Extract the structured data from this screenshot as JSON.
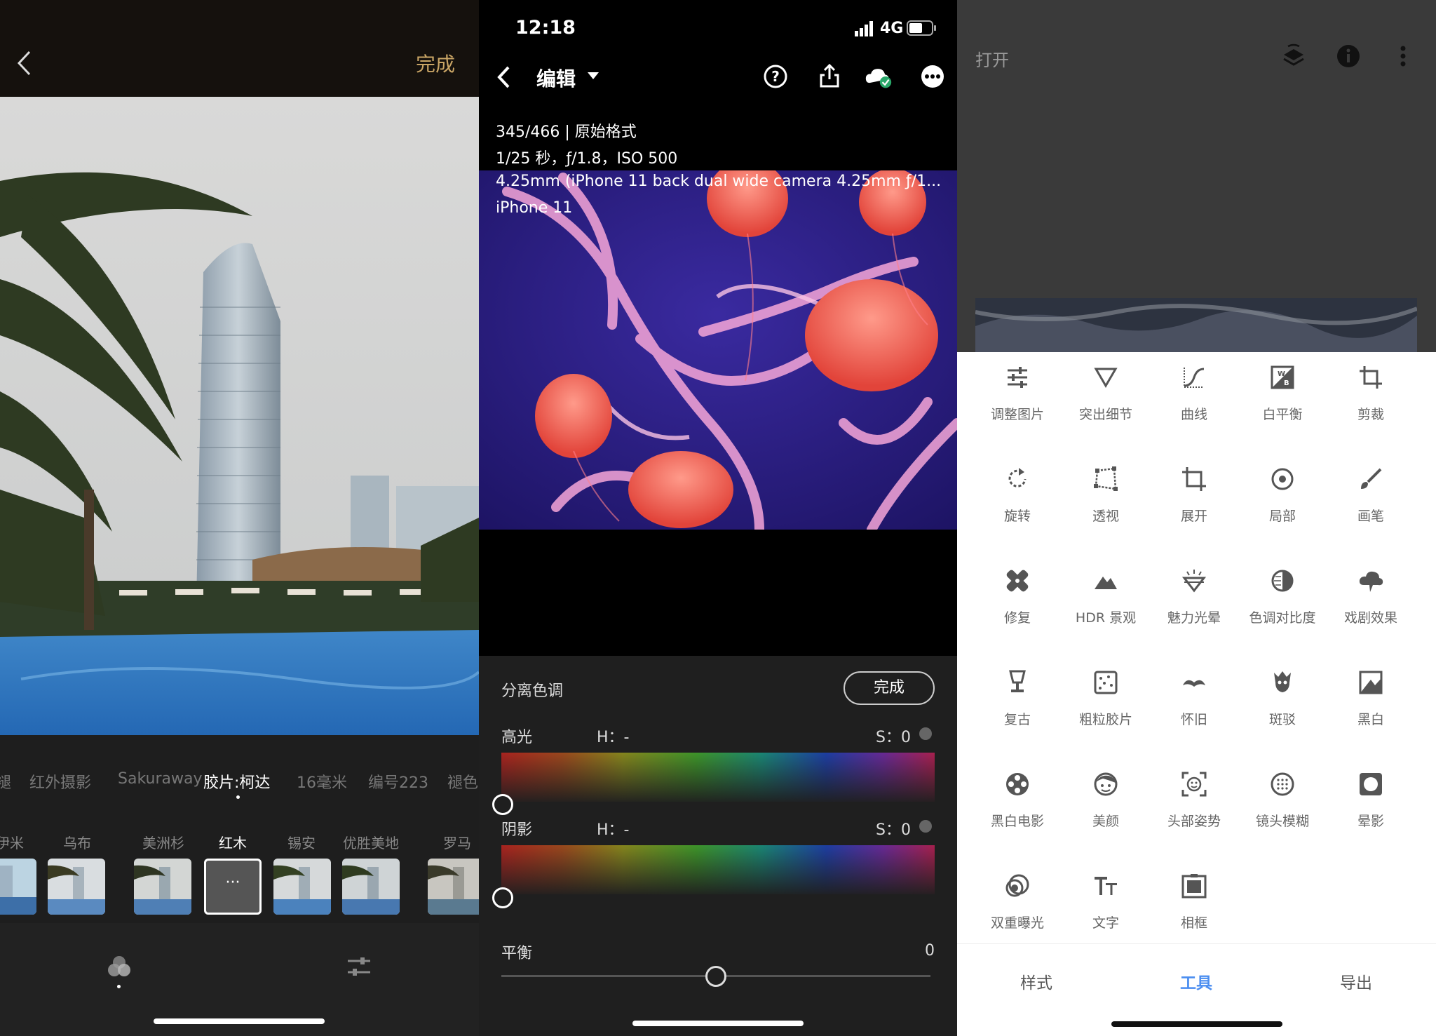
{
  "panel1": {
    "done_label": "完成",
    "filters": [
      {
        "label": "褪",
        "active": false
      },
      {
        "label": "红外摄影",
        "active": false
      },
      {
        "label": "Sakuraway",
        "active": false
      },
      {
        "label": "胶片:柯达",
        "active": true
      },
      {
        "label": "16毫米",
        "active": false
      },
      {
        "label": "编号223",
        "active": false
      },
      {
        "label": "褪色",
        "active": false
      }
    ],
    "presets": [
      {
        "label": "伊米",
        "active": false
      },
      {
        "label": "乌布",
        "active": false
      },
      {
        "label": "美洲杉",
        "active": false
      },
      {
        "label": "红木",
        "active": true
      },
      {
        "label": "锡安",
        "active": false
      },
      {
        "label": "优胜美地",
        "active": false
      },
      {
        "label": "罗马",
        "active": false
      }
    ],
    "selected_thumb_text": "···"
  },
  "panel2": {
    "time": "12:18",
    "network": "4G",
    "title": "编辑",
    "meta": [
      "345/466 | 原始格式",
      "1/25 秒，ƒ/1.8，ISO 500",
      "4.25mm (iPhone 11 back dual wide camera 4.25mm ƒ/1...",
      "iPhone 11"
    ],
    "section_title": "分离色调",
    "done_label": "完成",
    "highlight": {
      "label": "高光",
      "h_label": "H：-",
      "s_label": "S：0"
    },
    "shadow": {
      "label": "阴影",
      "h_label": "H：-",
      "s_label": "S：0"
    },
    "balance": {
      "label": "平衡",
      "value": "0",
      "position": 0.5
    }
  },
  "panel3": {
    "open_label": "打开",
    "tools": [
      {
        "label": "调整图片",
        "icon": "tune-icon"
      },
      {
        "label": "突出细节",
        "icon": "details-icon"
      },
      {
        "label": "曲线",
        "icon": "curves-icon"
      },
      {
        "label": "白平衡",
        "icon": "white-balance-icon"
      },
      {
        "label": "剪裁",
        "icon": "crop-icon"
      },
      {
        "label": "旋转",
        "icon": "rotate-icon"
      },
      {
        "label": "透视",
        "icon": "perspective-icon"
      },
      {
        "label": "展开",
        "icon": "expand-icon"
      },
      {
        "label": "局部",
        "icon": "selective-icon"
      },
      {
        "label": "画笔",
        "icon": "brush-icon"
      },
      {
        "label": "修复",
        "icon": "healing-icon"
      },
      {
        "label": "HDR 景观",
        "icon": "hdr-icon"
      },
      {
        "label": "魅力光晕",
        "icon": "glamour-glow-icon"
      },
      {
        "label": "色调对比度",
        "icon": "tonal-contrast-icon"
      },
      {
        "label": "戏剧效果",
        "icon": "drama-icon"
      },
      {
        "label": "复古",
        "icon": "vintage-icon"
      },
      {
        "label": "粗粒胶片",
        "icon": "grainy-film-icon"
      },
      {
        "label": "怀旧",
        "icon": "retrolux-icon"
      },
      {
        "label": "斑驳",
        "icon": "grunge-icon"
      },
      {
        "label": "黑白",
        "icon": "black-white-icon"
      },
      {
        "label": "黑白电影",
        "icon": "noir-icon"
      },
      {
        "label": "美颜",
        "icon": "face-icon"
      },
      {
        "label": "头部姿势",
        "icon": "head-pose-icon"
      },
      {
        "label": "镜头模糊",
        "icon": "lens-blur-icon"
      },
      {
        "label": "晕影",
        "icon": "vignette-icon"
      },
      {
        "label": "双重曝光",
        "icon": "double-exposure-icon"
      },
      {
        "label": "文字",
        "icon": "text-icon"
      },
      {
        "label": "相框",
        "icon": "frame-icon"
      }
    ],
    "tabs": [
      {
        "label": "样式",
        "active": false
      },
      {
        "label": "工具",
        "active": true
      },
      {
        "label": "导出",
        "active": false
      }
    ]
  }
}
